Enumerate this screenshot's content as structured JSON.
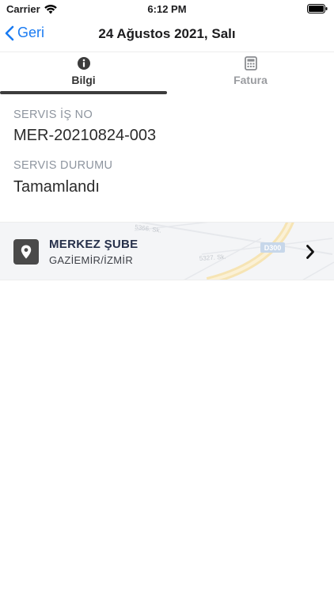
{
  "status_bar": {
    "carrier": "Carrier",
    "time": "6:12 PM"
  },
  "navbar": {
    "back_label": "Geri",
    "title": "24 Ağustos 2021, Salı"
  },
  "tabs": [
    {
      "label": "Bilgi",
      "icon": "info-circle-icon",
      "selected": true
    },
    {
      "label": "Fatura",
      "icon": "calculator-icon",
      "selected": false
    }
  ],
  "details": {
    "service_no_label": "SERVIS İŞ NO",
    "service_no_value": "MER-20210824-003",
    "service_status_label": "SERVIS DURUMU",
    "service_status_value": "Tamamlandı"
  },
  "location": {
    "name": "MERKEZ ŞUBE",
    "city": "GAZİEMİR/İZMİR",
    "map_labels": [
      "5366. Sk.",
      "5327. Sk.",
      "D300"
    ]
  },
  "colors": {
    "accent": "#1a7bf2",
    "tab_active": "#3c3c3c",
    "tab_inactive": "#9a9ca0",
    "label_gray": "#8e959f"
  }
}
